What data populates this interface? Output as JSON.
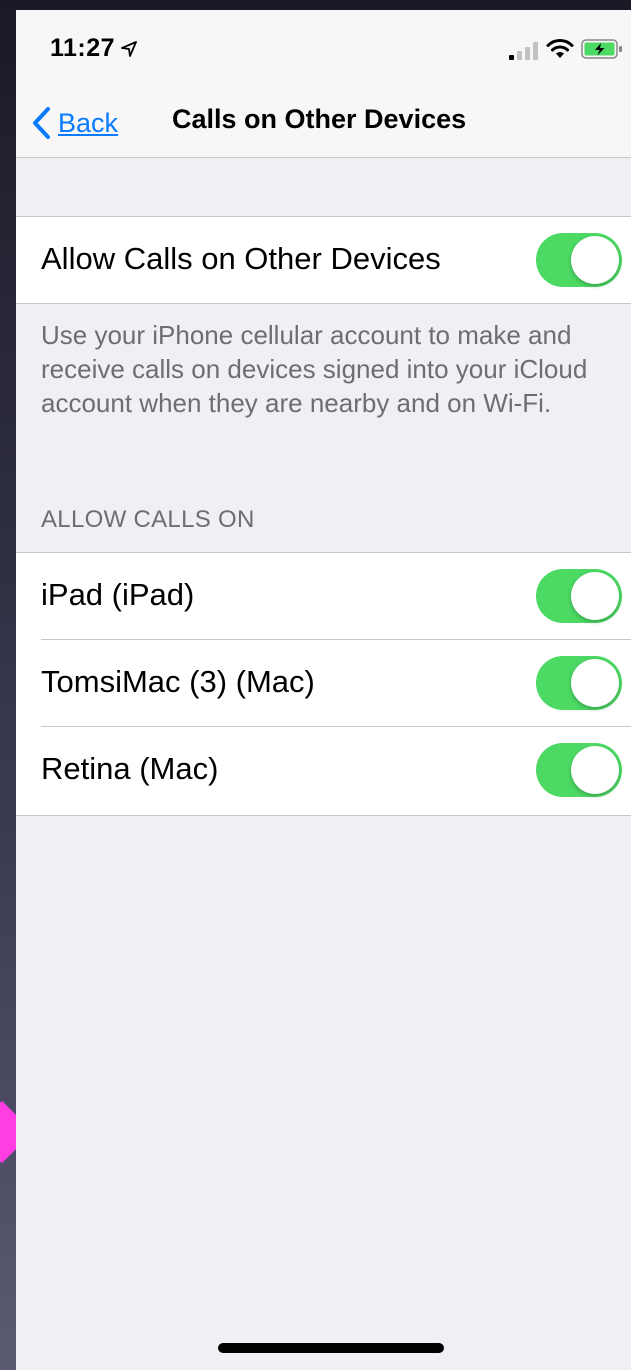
{
  "status_bar": {
    "time": "11:27",
    "icons": [
      "location-arrow-icon",
      "signal-icon",
      "wifi-icon",
      "battery-charging-icon"
    ]
  },
  "nav": {
    "back_label": "Back",
    "title": "Calls on Other Devices"
  },
  "main_toggle": {
    "label": "Allow Calls on Other Devices",
    "on": true
  },
  "description": "Use your iPhone cellular account to make and receive calls on devices signed into your iCloud account when they are nearby and on Wi-Fi.",
  "devices_section": {
    "header": "ALLOW CALLS ON",
    "items": [
      {
        "label": "iPad (iPad)",
        "on": true
      },
      {
        "label": "TomsiMac (3) (Mac)",
        "on": true
      },
      {
        "label": "Retina (Mac)",
        "on": true
      }
    ]
  },
  "colors": {
    "accent": "#0a7aff",
    "toggle_on": "#4cd964",
    "background": "#efeff4",
    "secondary_text": "#6d6d72"
  }
}
